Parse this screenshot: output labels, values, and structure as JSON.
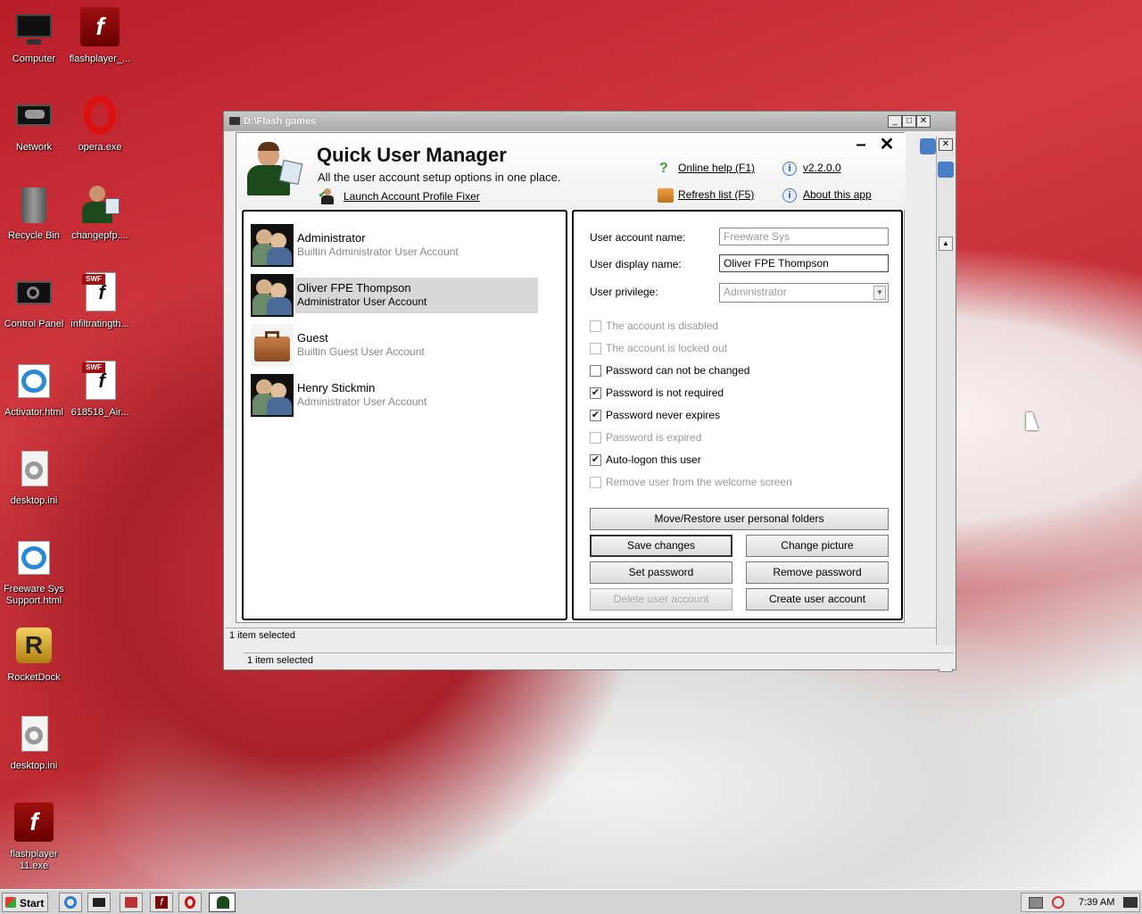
{
  "desktop_icons": [
    {
      "label": "Computer",
      "icon": "monitor-icon"
    },
    {
      "label": "flashplayer_...",
      "icon": "flash-icon"
    },
    {
      "label": "Network",
      "icon": "network-icon"
    },
    {
      "label": "opera.exe",
      "icon": "opera-icon"
    },
    {
      "label": "Recycle Bin",
      "icon": "recycle-bin-icon"
    },
    {
      "label": "changepfp....",
      "icon": "user-manager-icon"
    },
    {
      "label": "Control Panel",
      "icon": "control-panel-icon"
    },
    {
      "label": "infiltratingth...",
      "icon": "swf-file-icon"
    },
    {
      "label": "Activator.html",
      "icon": "ie-icon"
    },
    {
      "label": "618518_Air...",
      "icon": "swf-file-icon"
    },
    {
      "label": "desktop.ini",
      "icon": "settings-file-icon"
    },
    {
      "label": "Freeware Sys Support.html",
      "icon": "ie-icon"
    },
    {
      "label": "RocketDock",
      "icon": "rocketdock-icon"
    },
    {
      "label": "desktop.ini",
      "icon": "settings-file-icon"
    },
    {
      "label": "flashplayer 11.exe",
      "icon": "flash-icon"
    }
  ],
  "explorer": {
    "title": "D:\\Flash games",
    "status_inner": "1 item selected",
    "status_outer": "1 item selected"
  },
  "app": {
    "title": "Quick User Manager",
    "subtitle": "All the user account setup options in one place.",
    "launch_fixer": "Launch Account Profile Fixer",
    "online_help": "Online help (F1)",
    "version": "v2.2.0.0",
    "refresh": "Refresh list (F5)",
    "about": "About this app",
    "minimize": "–",
    "close": "✕"
  },
  "users": [
    {
      "name": "Administrator",
      "desc": "Builtin Administrator User Account",
      "selected": false
    },
    {
      "name": "Oliver FPE Thompson",
      "desc": "Administrator User Account",
      "selected": true
    },
    {
      "name": "Guest",
      "desc": "Builtin Guest User Account",
      "selected": false
    },
    {
      "name": "Henry Stickmin",
      "desc": "Administrator User Account",
      "selected": false
    }
  ],
  "form": {
    "account_name_label": "User account name:",
    "account_name_value": "Freeware Sys",
    "display_name_label": "User display name:",
    "display_name_value": "Oliver FPE Thompson",
    "privilege_label": "User privilege:",
    "privilege_value": "Administrator"
  },
  "checkboxes": [
    {
      "label": "The account is disabled",
      "checked": false,
      "enabled": false
    },
    {
      "label": "The account is locked out",
      "checked": false,
      "enabled": false
    },
    {
      "label": "Password can not be changed",
      "checked": false,
      "enabled": true
    },
    {
      "label": "Password is not required",
      "checked": true,
      "enabled": true
    },
    {
      "label": "Password never expires",
      "checked": true,
      "enabled": true
    },
    {
      "label": "Password is expired",
      "checked": false,
      "enabled": false
    },
    {
      "label": "Auto-logon this user",
      "checked": true,
      "enabled": true
    },
    {
      "label": "Remove user from the welcome screen",
      "checked": false,
      "enabled": false
    }
  ],
  "buttons": {
    "move_restore": "Move/Restore user personal folders",
    "save": "Save changes",
    "change_picture": "Change picture",
    "set_password": "Set password",
    "remove_password": "Remove password",
    "delete_account": "Delete user account",
    "create_account": "Create user account"
  },
  "taskbar": {
    "start": "Start",
    "time": "7:39 AM"
  }
}
